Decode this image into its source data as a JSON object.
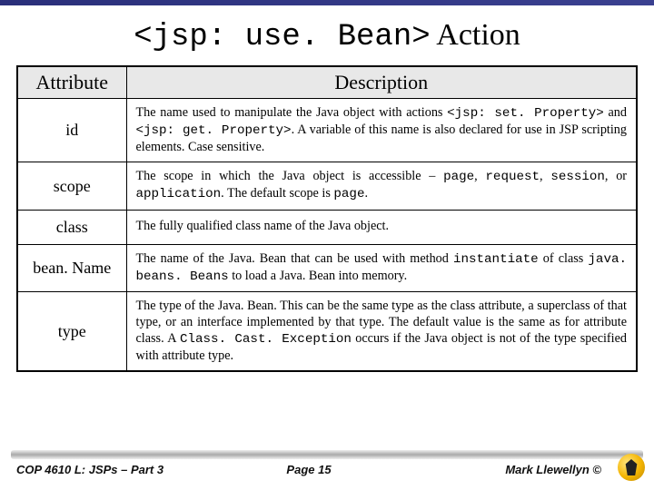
{
  "title_code": "<jsp: use. Bean>",
  "title_suffix": " Action",
  "columns": {
    "attribute": "Attribute",
    "description": "Description"
  },
  "rows": [
    {
      "attr": "id",
      "desc_html": "The name used to manipulate the Java object with actions <span class=\"mono\">&lt;jsp: set. Property&gt;</span> and <span class=\"mono\">&lt;jsp: get. Property&gt;</span>. A variable of this name is also declared for use in JSP scripting elements. Case sensitive."
    },
    {
      "attr": "scope",
      "desc_html": "The scope in which the Java object is accessible – <span class=\"mono\">page</span>, <span class=\"mono\">request</span>, <span class=\"mono\">session</span>, or <span class=\"mono\">application</span>. The default scope is <span class=\"mono\">page</span>."
    },
    {
      "attr": "class",
      "desc_html": "The fully qualified class name of the Java object."
    },
    {
      "attr": "bean. Name",
      "desc_html": "The name of the Java. Bean that can be used with method <span class=\"mono\">instantiate</span> of class <span class=\"mono\">java. beans. Beans</span> to load a Java. Bean into memory."
    },
    {
      "attr": "type",
      "desc_html": "The type of the Java. Bean. This can be the same type as the class attribute, a superclass of that type, or an interface implemented by that type. The default value is the same as for attribute class. A <span class=\"mono\">Class. Cast. Exception</span> occurs if the Java object is not of the type specified with attribute type."
    }
  ],
  "footer": {
    "left": "COP 4610 L: JSPs – Part 3",
    "center": "Page 15",
    "right": "Mark Llewellyn ©"
  }
}
